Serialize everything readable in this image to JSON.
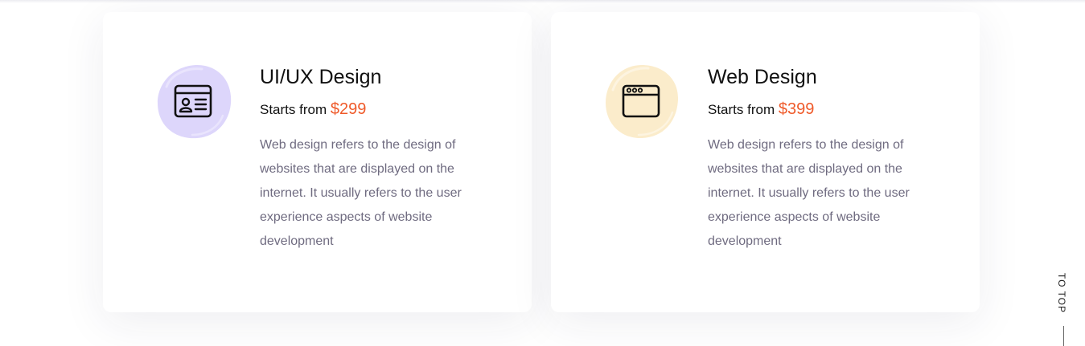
{
  "services": [
    {
      "title": "UI/UX Design",
      "price_prefix": "Starts from",
      "price": "$299",
      "description": "Web design refers to the design of websites that are displayed on the internet. It usually refers to the user experience aspects of website development",
      "icon": "profile-card-icon",
      "icon_bg": "#ddd6fb"
    },
    {
      "title": "Web Design",
      "price_prefix": "Starts from",
      "price": "$399",
      "description": "Web design refers to the design of websites that are displayed on the internet. It usually refers to the user experience aspects of website development",
      "icon": "browser-window-icon",
      "icon_bg": "#fbeccb"
    }
  ],
  "to_top": {
    "label": "TO TOP"
  },
  "colors": {
    "accent": "#ef5a2a",
    "body_text": "#6f6b80",
    "heading": "#111111"
  }
}
